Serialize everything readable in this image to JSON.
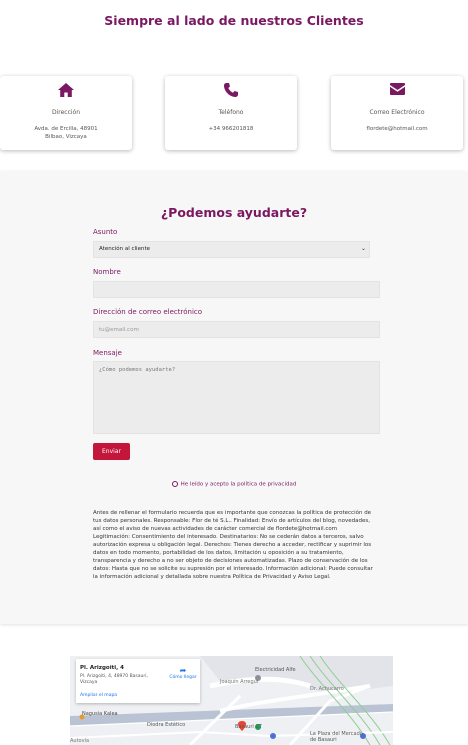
{
  "title": "Siempre al lado de nuestros Clientes",
  "contact_cards": [
    {
      "icon": "home-icon",
      "label": "Dirección",
      "value_line1": "Avda. de Ercilla, 48901",
      "value_line2": "Bilbao, Vizcaya"
    },
    {
      "icon": "phone-icon",
      "label": "Teléfono",
      "value_line1": "+34 966201818",
      "value_line2": ""
    },
    {
      "icon": "envelope-icon",
      "label": "Correo Electrónico",
      "value_line1": "flordete@hotmail.com",
      "value_line2": ""
    }
  ],
  "form": {
    "heading": "¿Podemos ayudarte?",
    "subject_label": "Asunto",
    "subject_selected": "Atención al cliente",
    "name_label": "Nombre",
    "name_value": "",
    "email_label": "Dirección de correo electrónico",
    "email_placeholder": "tu@email.com",
    "message_label": "Mensaje",
    "message_placeholder": "¿Cómo podemos ayudarte?",
    "submit_label": "Enviar",
    "privacy_label": "He leído y acepto la política de privacidad",
    "legal_text": "Antes de rellenar el formulario recuerda que es importante que conozcas la política de protección de tus datos personales. Responsable: Flor de té S.L.. Finalidad: Envío de artículos del blog, novedades, así como el aviso de nuevas actividades de carácter comercial de flordete@hotmail.com Legitimación: Consentimiento del interesado. Destinatarios: No se cederán datos a terceros, salvo autorización expresa u obligación legal. Derechos: Tienes derecho a acceder, rectificar y suprimir los datos en todo momento, portabilidad de los datos, limitación u oposición a su tratamiento, transparencia y derecho a no ser objeto de decisiones automatizadas. Plazo de conservación de los datos: Hasta que no se solicite su supresión por el interesado. Información adicional: Puede consultar la información adicional y detallada sobre nuestra Política de Privacidad y Aviso Legal."
  },
  "map": {
    "place_title": "Pl. Arizgoiti, 4",
    "place_address": "Pl. Arizgoiti, 4, 48970 Basauri, Vizcaya",
    "directions_label": "Cómo llegar",
    "expand_label": "Ampliar el mapa",
    "labels": {
      "electricidad": "Electricidad Alfe",
      "joaquin": "Joaquín Arregui",
      "dr_achucarro": "Dr. Achucarro",
      "nagusia": "Nagusia Kalea",
      "diodra": "Diodra Estético",
      "basauri": "Basauri CT",
      "plaza": "La Plaza del Mercado de Basauri",
      "autovia": "Autovía"
    },
    "accent": "#1a73e8"
  },
  "colors": {
    "brand": "#7a1862",
    "button": "#c3163a",
    "field": "#ececec"
  }
}
